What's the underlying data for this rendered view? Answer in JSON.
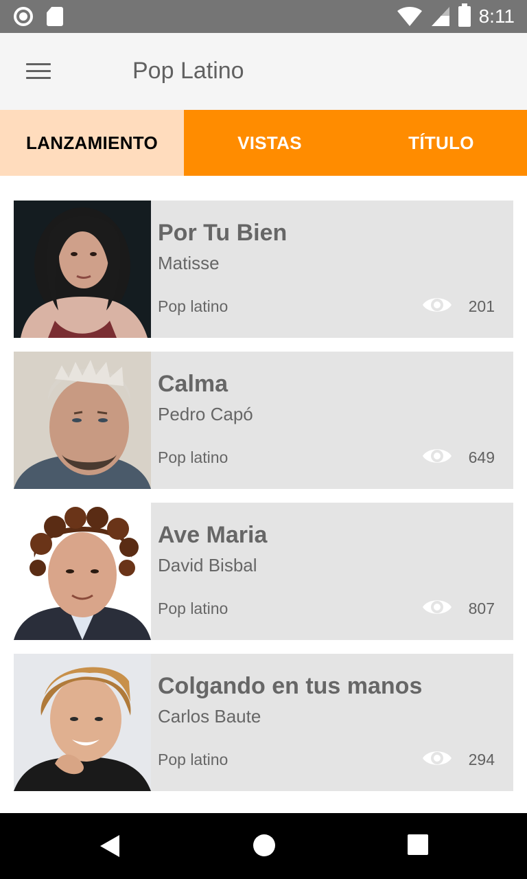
{
  "status_bar": {
    "time": "8:11",
    "left_icons": [
      "record-circle-icon",
      "sd-card-icon"
    ],
    "right_icons": [
      "wifi-icon",
      "cell-signal-icon",
      "battery-icon"
    ]
  },
  "app_bar": {
    "title": "Pop Latino",
    "menu_icon": "hamburger-menu-icon"
  },
  "tabs": [
    {
      "label": "LANZAMIENTO",
      "active": true
    },
    {
      "label": "VISTAS",
      "active": false
    },
    {
      "label": "TÍTULO",
      "active": false
    }
  ],
  "colors": {
    "accent": "#ff8c00",
    "active_tab_bg": "#ffdcbd",
    "card_bg": "#e4e4e4",
    "text_gray": "#666666"
  },
  "songs": [
    {
      "title": "Por Tu Bien",
      "artist": "Matisse",
      "genre": "Pop latino",
      "views": "201"
    },
    {
      "title": "Calma",
      "artist": "Pedro Capó",
      "genre": "Pop latino",
      "views": "649"
    },
    {
      "title": "Ave Maria",
      "artist": "David Bisbal",
      "genre": "Pop latino",
      "views": "807"
    },
    {
      "title": "Colgando en tus manos",
      "artist": "Carlos Baute",
      "genre": "Pop latino",
      "views": "294"
    }
  ],
  "nav_bar": {
    "buttons": [
      "back-icon",
      "home-icon",
      "recents-icon"
    ]
  }
}
